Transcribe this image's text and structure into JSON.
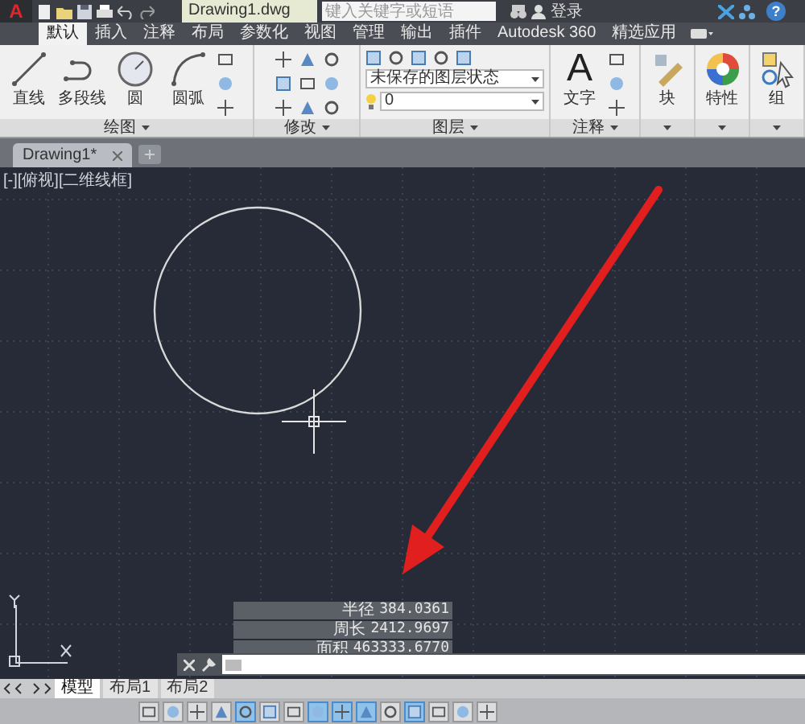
{
  "app_button": {
    "logo": "A"
  },
  "title_bar": {
    "document": "Drawing1.dwg",
    "search": {
      "placeholder": "键入关键字或短语"
    },
    "login": "登录",
    "help": "?"
  },
  "ribbon_tabs": [
    {
      "label": "默认",
      "selected": true
    },
    {
      "label": "插入",
      "selected": false
    },
    {
      "label": "注释",
      "selected": false
    },
    {
      "label": "布局",
      "selected": false
    },
    {
      "label": "参数化",
      "selected": false
    },
    {
      "label": "视图",
      "selected": false
    },
    {
      "label": "管理",
      "selected": false
    },
    {
      "label": "输出",
      "selected": false
    },
    {
      "label": "插件",
      "selected": false
    },
    {
      "label": "Autodesk 360",
      "selected": false
    },
    {
      "label": "精选应用",
      "selected": false
    }
  ],
  "ribbon_panels": [
    {
      "kind": "draw",
      "title": "绘图",
      "tools": [
        {
          "label": "直线",
          "kind": "line"
        },
        {
          "label": "多段线",
          "kind": "polyline"
        },
        {
          "label": "圆",
          "kind": "circle"
        },
        {
          "label": "圆弧",
          "kind": "arc"
        }
      ]
    },
    {
      "kind": "modify",
      "title": "修改"
    },
    {
      "kind": "layers",
      "title": "图层",
      "layer_state": "未保存的图层状态",
      "current_layer": "0"
    },
    {
      "kind": "annotation",
      "title": "注释",
      "tools": [
        {
          "label": "文字",
          "kind": "letter",
          "glyph": "A"
        }
      ]
    },
    {
      "kind": "single",
      "tools": [
        {
          "label": "块",
          "kind": "block"
        }
      ]
    },
    {
      "kind": "single",
      "tools": [
        {
          "label": "特性",
          "kind": "palette"
        }
      ]
    },
    {
      "kind": "single",
      "tools": [
        {
          "label": "组",
          "kind": "group"
        }
      ]
    }
  ],
  "document_tabs": [
    {
      "label": "Drawing1*",
      "selected": true
    }
  ],
  "viewport": {
    "label": "[-][俯视][二维线框]"
  },
  "tooltip": [
    {
      "label": "半径",
      "value": "384.0361"
    },
    {
      "label": "周长",
      "value": "2412.9697"
    },
    {
      "label": "面积",
      "value": "463333.6770"
    }
  ],
  "layout_tabs": [
    {
      "label": "模型",
      "selected": true
    },
    {
      "label": "布局1",
      "selected": false
    },
    {
      "label": "布局2",
      "selected": false
    }
  ],
  "status_bar": [
    {
      "on": false
    },
    {
      "on": false
    },
    {
      "on": false
    },
    {
      "on": false
    },
    {
      "on": true
    },
    {
      "on": false
    },
    {
      "on": false
    },
    {
      "on": true
    },
    {
      "on": true
    },
    {
      "on": true
    },
    {
      "on": false
    },
    {
      "on": true
    },
    {
      "on": false
    },
    {
      "on": false
    },
    {
      "on": false
    }
  ]
}
